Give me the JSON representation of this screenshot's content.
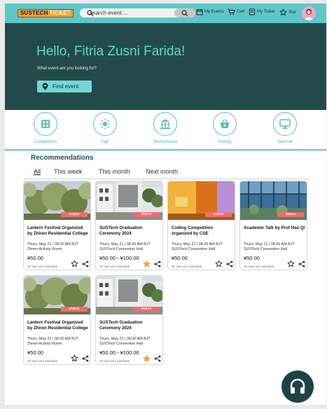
{
  "header": {
    "logo_part1": "SUSTECH",
    "logo_part2": "TICKET",
    "search_placeholder": "search event....",
    "nav": [
      {
        "label": "My Events",
        "icon": "calendar-icon"
      },
      {
        "label": "Cart",
        "icon": "cart-icon"
      },
      {
        "label": "My Ticket",
        "icon": "ticket-icon"
      },
      {
        "label": "Star",
        "icon": "star-icon"
      }
    ]
  },
  "hero": {
    "greeting": "Hello, Fitria Zusni Farida!",
    "subtitle": "What event are you looking for?",
    "find_button": "Find event"
  },
  "categories": [
    {
      "label": "Competition",
      "icon": "calculator-icon"
    },
    {
      "label": "Fair",
      "icon": "sun-icon"
    },
    {
      "label": "Performance",
      "icon": "museum-icon"
    },
    {
      "label": "Activity",
      "icon": "basket-icon"
    },
    {
      "label": "Seminar",
      "icon": "monitor-icon"
    }
  ],
  "recommendations": {
    "title": "Recommendations",
    "tabs": [
      "All",
      "This week",
      "This month",
      "Next month"
    ],
    "active_tab": "All"
  },
  "events": [
    {
      "status": "status",
      "title": "Lantern Festival Organized by Zhiren Residential College",
      "date": "Thurs, May 21 | 08.00 AM BJT",
      "venue": "Zhiren Activity Room",
      "price": "¥50.00",
      "sold": "20 sold 167 available",
      "starred": false,
      "image": "tree"
    },
    {
      "status": "status",
      "title": "SUSTech Graduation Ceremony 2024",
      "date": "Thurs, May 21 | 08.00 AM BJT",
      "venue": "SUSTech Convention Hall",
      "price": "¥50.00 - ¥100.00",
      "sold": "20 sold 167 available",
      "starred": true,
      "image": "building"
    },
    {
      "status": "status",
      "title": "Coding Competition organized by CSE",
      "date": "Thurs, May 21 | 08.00 AM BJT",
      "venue": "SUSTech Convention Hall",
      "price": "¥50.00",
      "sold": "20 sold 167 available",
      "starred": false,
      "image": "orange"
    },
    {
      "status": "status",
      "title": "Academic Talk by Prof Hao Qi",
      "date": "Thurs, May 21 | 08.00 AM BJT",
      "venue": "SUSTech Convention Hall",
      "price": "¥50.00",
      "sold": "20 sold 167 available",
      "starred": false,
      "image": "glass"
    },
    {
      "status": "status",
      "title": "Lantern Festival Organized by Zhiren Residential College",
      "date": "Thurs, May 21 | 08.00 AM BJT",
      "venue": "Zhiren Activity Room",
      "price": "¥50.00",
      "sold": "20 sold 167 available",
      "starred": false,
      "image": "tree"
    },
    {
      "status": "status",
      "title": "SUSTech Graduation Ceremony 2024",
      "date": "Thurs, May 21 | 08.00 AM BJT",
      "venue": "SUSTech Convention Hall",
      "price": "¥50.00 - ¥100.00",
      "sold": "20 sold 167 available",
      "starred": true,
      "image": "building"
    }
  ],
  "colors": {
    "teal": "#5fc7c7",
    "dark_teal": "#234a4b",
    "status_red": "#f26b73",
    "star_orange": "#f2a33a"
  },
  "support_icon": "headset-icon"
}
